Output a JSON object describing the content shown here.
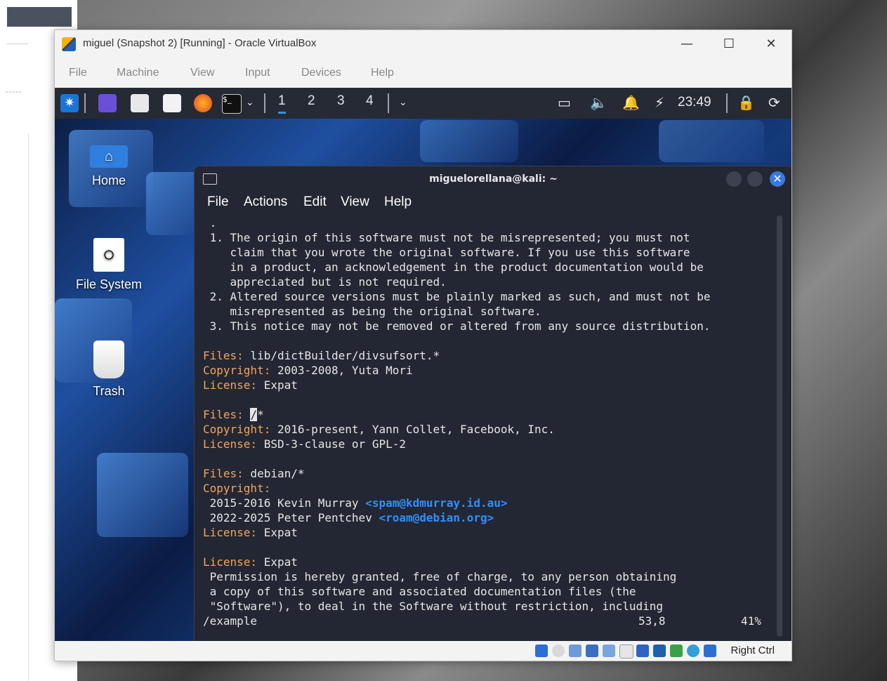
{
  "vbox": {
    "title": "miguel (Snapshot 2) [Running] - Oracle VirtualBox",
    "menu": [
      "File",
      "Machine",
      "View",
      "Input",
      "Devices",
      "Help"
    ],
    "host_key": "Right Ctrl"
  },
  "panel": {
    "workspaces": [
      "1",
      "2",
      "3",
      "4"
    ],
    "clock": "23:49"
  },
  "desktop": {
    "icons": [
      "Home",
      "File System",
      "Trash"
    ]
  },
  "terminal": {
    "title": "miguelorellana@kali: ~",
    "menu": [
      "File",
      "Actions",
      "Edit",
      "View",
      "Help"
    ],
    "lines": {
      "l00": " .",
      "l01": " 1. The origin of this software must not be misrepresented; you must not",
      "l02": "    claim that you wrote the original software. If you use this software",
      "l03": "    in a product, an acknowledgement in the product documentation would be",
      "l04": "    appreciated but is not required.",
      "l05": " 2. Altered source versions must be plainly marked as such, and must not be",
      "l06": "    misrepresented as being the original software.",
      "l07": " 3. This notice may not be removed or altered from any source distribution.",
      "k_files": "Files:",
      "k_copyright": "Copyright:",
      "k_license": "License:",
      "v_files1": " lib/dictBuilder/divsufsort.*",
      "v_copy1": " 2003-2008, Yuta Mori",
      "v_lic1": " Expat",
      "v_files2_cursor": "/",
      "v_files2_rest": "*",
      "v_copy2": " 2016-present, Yann Collet, Facebook, Inc.",
      "v_lic2": " BSD-3-clause or GPL-2",
      "v_files3": " debian/*",
      "c1_text": " 2015-2016 Kevin Murray ",
      "c1_email": "<spam@kdmurray.id.au>",
      "c2_text": " 2022-2025 Peter Pentchev ",
      "c2_email": "<roam@debian.org>",
      "v_lic3": " Expat",
      "v_lic4": " Expat",
      "p1": " Permission is hereby granted, free of charge, to any person obtaining",
      "p2": " a copy of this software and associated documentation files (the",
      "p3": " \"Software\"), to deal in the Software without restriction, including",
      "status_search": "/example",
      "status_pos": "53,8",
      "status_pct": "41%"
    }
  },
  "colors": {
    "accent": "#3779dd",
    "key": "#f2a45c",
    "email": "#2f8fff",
    "terminal_bg": "#232733"
  }
}
